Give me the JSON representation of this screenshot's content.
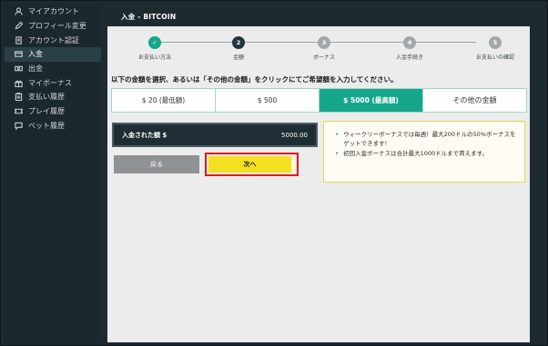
{
  "header": {
    "title": "入金 - BITCOIN"
  },
  "sidebar": {
    "items": [
      {
        "label": "マイアカウント",
        "icon": "user-icon"
      },
      {
        "label": "プロフィール変更",
        "icon": "pencil-icon"
      },
      {
        "label": "アカウント認証",
        "icon": "document-icon"
      },
      {
        "label": "入金",
        "icon": "card-icon",
        "active": true
      },
      {
        "label": "出金",
        "icon": "cash-icon"
      },
      {
        "label": "マイボーナス",
        "icon": "gift-icon"
      },
      {
        "label": "支払い履歴",
        "icon": "clipboard-icon"
      },
      {
        "label": "プレイ履歴",
        "icon": "ticket-icon"
      },
      {
        "label": "ベット履歴",
        "icon": "chat-icon"
      }
    ]
  },
  "steps": [
    {
      "number": "✓",
      "label": "お支払い方法",
      "state": "done"
    },
    {
      "number": "2",
      "label": "金額",
      "state": "current"
    },
    {
      "number": "3",
      "label": "ボーナス",
      "state": "pending"
    },
    {
      "number": "4",
      "label": "入金手続き",
      "state": "pending"
    },
    {
      "number": "5",
      "label": "お支払いの確認",
      "state": "pending"
    }
  ],
  "instruction": "以下の金額を選択、あるいは「その他の金額」をクリックにてご希望額を入力してください。",
  "amounts": [
    {
      "label": "$ 20 (最低額)"
    },
    {
      "label": "$ 500"
    },
    {
      "label": "$ 5000 (最高額)",
      "selected": true
    },
    {
      "label": "その他の金額"
    }
  ],
  "deposit": {
    "label": "入金された額 $",
    "value": "5000.00"
  },
  "buttons": {
    "back": "戻る",
    "next": "次へ"
  },
  "bonus_info": [
    "ウィークリーボーナスでは毎週！最大200ドルの50%ボーナスをゲットできます!",
    "初回入金ボーナスは合計最大1000ドルまで貰えます。"
  ],
  "colors": {
    "accent": "#16a78b",
    "next_button": "#f4e021",
    "highlight_border": "#e01b1b",
    "dark": "#1d2a30"
  }
}
